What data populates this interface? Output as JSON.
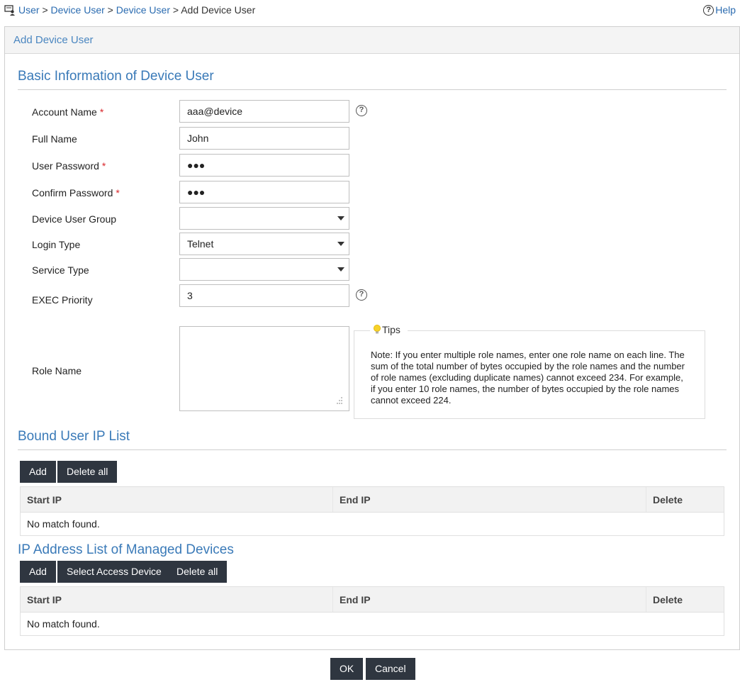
{
  "breadcrumb": {
    "items": [
      "User",
      "Device User",
      "Device User"
    ],
    "separator": ">",
    "current": "Add Device User"
  },
  "help": {
    "icon": "?",
    "label": "Help"
  },
  "panel": {
    "title": "Add Device User"
  },
  "basic": {
    "title": "Basic Information of Device User",
    "required_mark": "*",
    "help_icon": "?",
    "account_name": {
      "label": "Account Name",
      "value": "aaa@device"
    },
    "full_name": {
      "label": "Full Name",
      "value": "John"
    },
    "user_password": {
      "label": "User Password",
      "value": "●●●"
    },
    "confirm_password": {
      "label": "Confirm Password",
      "value": "●●●"
    },
    "device_user_group": {
      "label": "Device User Group",
      "value": ""
    },
    "login_type": {
      "label": "Login Type",
      "value": "Telnet"
    },
    "service_type": {
      "label": "Service Type",
      "value": ""
    },
    "exec_priority": {
      "label": "EXEC Priority",
      "value": "3"
    },
    "role_name": {
      "label": "Role Name",
      "value": ""
    }
  },
  "tips": {
    "title": "Tips",
    "text": "Note: If you enter multiple role names, enter one role name on each line. The sum of the total number of bytes occupied by the role names and the number of role names (excluding duplicate names) cannot exceed 234. For example, if you enter 10 role names, the number of bytes occupied by the role names cannot exceed 224."
  },
  "bound_ip": {
    "title": "Bound User IP List",
    "buttons": {
      "add": "Add",
      "delete_all": "Delete all"
    },
    "columns": [
      "Start IP",
      "End IP",
      "Delete"
    ],
    "empty": "No match found."
  },
  "managed_ip": {
    "title": "IP Address List of Managed Devices",
    "buttons": {
      "add": "Add",
      "select_access_device": "Select Access Device",
      "delete_all": "Delete all"
    },
    "columns": [
      "Start IP",
      "End IP",
      "Delete"
    ],
    "empty": "No match found."
  },
  "footer": {
    "ok": "OK",
    "cancel": "Cancel"
  },
  "colors": {
    "accent": "#3a7ab8",
    "link": "#2a6bb0",
    "button": "#2f3640",
    "required": "#d9262b"
  }
}
